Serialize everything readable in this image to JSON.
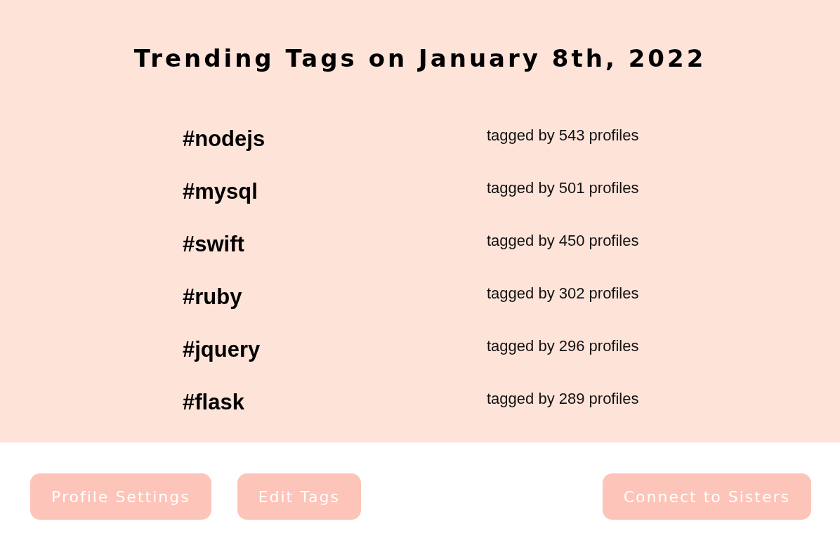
{
  "title": "Trending Tags on January 8th, 2022",
  "tags": [
    {
      "tag": "#nodejs",
      "count": "tagged by 543 profiles"
    },
    {
      "tag": "#mysql",
      "count": "tagged by 501 profiles"
    },
    {
      "tag": "#swift",
      "count": "tagged by 450 profiles"
    },
    {
      "tag": "#ruby",
      "count": "tagged by 302 profiles"
    },
    {
      "tag": "#jquery",
      "count": "tagged by 296 profiles"
    },
    {
      "tag": "#flask",
      "count": "tagged by 289 profiles"
    }
  ],
  "buttons": [
    {
      "label": "Profile Settings"
    },
    {
      "label": "Edit Tags"
    },
    {
      "label": "Connect to Sisters"
    }
  ]
}
